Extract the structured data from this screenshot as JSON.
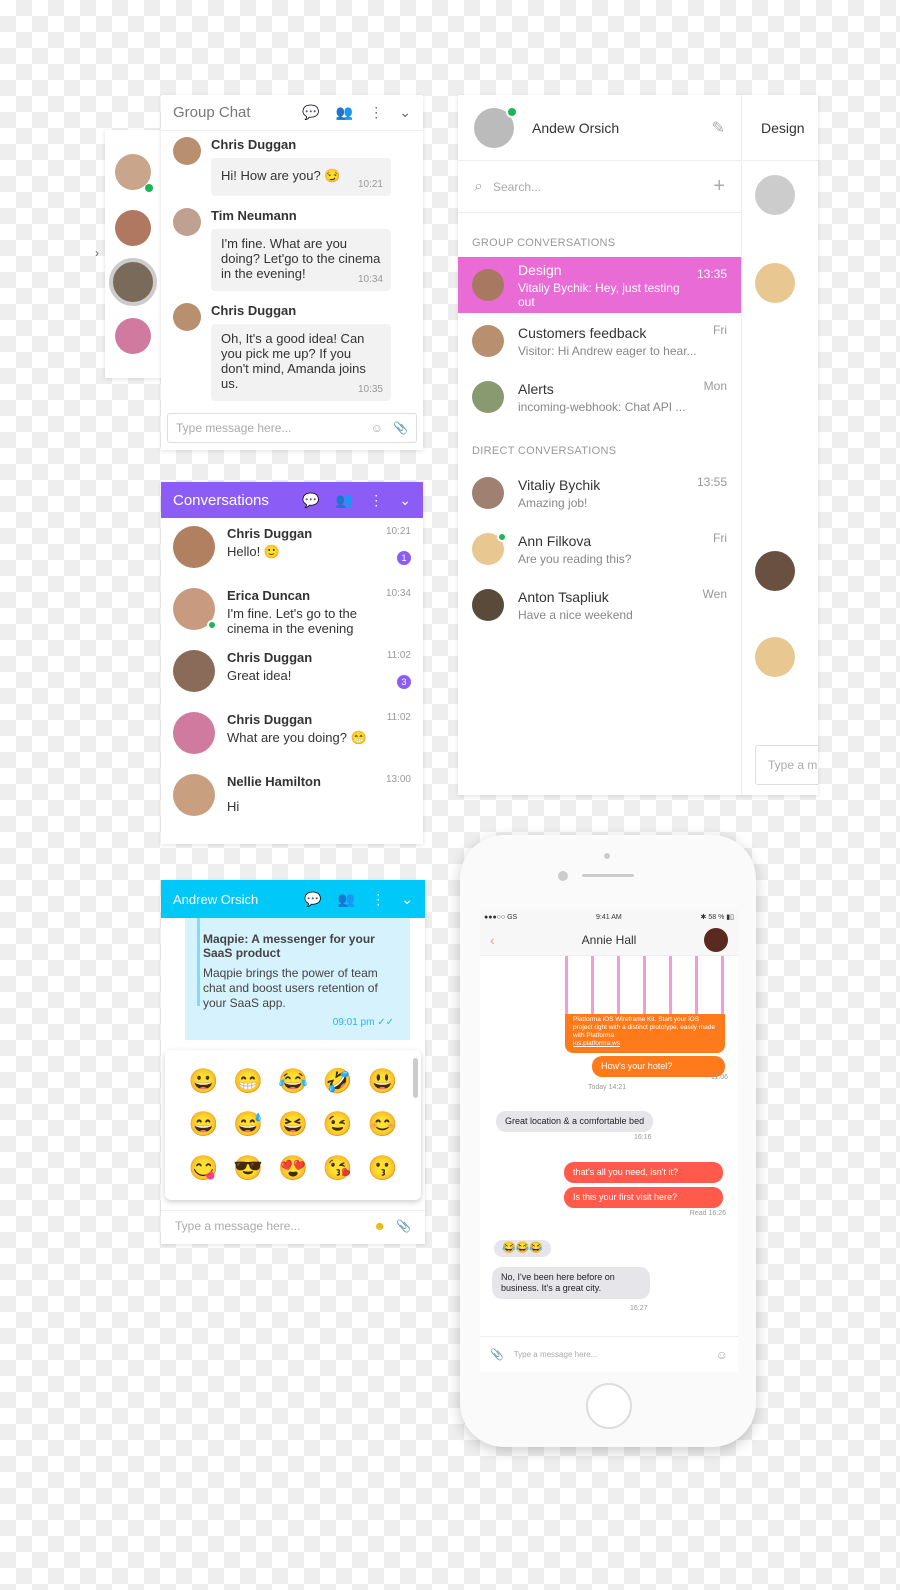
{
  "group_chat": {
    "title": "Group Chat",
    "messages": [
      {
        "name": "Chris Duggan",
        "text": "Hi! How are you? 😏",
        "time": "10:21"
      },
      {
        "name": "Tim Neumann",
        "text": "I'm fine. What are you doing? Let'go to the cinema in the evening!",
        "time": "10:34"
      },
      {
        "name": "Chris Duggan",
        "text": "Oh, It's a good idea! Can you pick me up? If you don't mind, Amanda joins us.",
        "time": "10:35"
      }
    ],
    "input_placeholder": "Type message here..."
  },
  "conversations": {
    "title": "Conversations",
    "header_color": "#8b5cf6",
    "items": [
      {
        "name": "Chris Duggan",
        "text": "Hello! 🙂",
        "time": "10:21",
        "badge": "1"
      },
      {
        "name": "Erica Duncan",
        "text": "I'm fine. Let's go to the cinema in the evening",
        "time": "10:34",
        "badge": ""
      },
      {
        "name": "Chris Duggan",
        "text": "Great idea!",
        "time": "11:02",
        "badge": "3"
      },
      {
        "name": "Chris Duggan",
        "text": "What are you doing? 😁",
        "time": "11:02",
        "badge": ""
      },
      {
        "name": "Nellie Hamilton",
        "text": "Hi",
        "time": "13:00",
        "badge": ""
      }
    ]
  },
  "andrew_panel": {
    "title": "Andrew Orsich",
    "header_color": "#00c8f8",
    "card_title": "Maqpie: A messenger for your SaaS product",
    "card_body": "Maqpie brings the power of team chat and boost users retention of your SaaS app.",
    "card_time": "09:01 pm",
    "emojis": [
      "😀",
      "😁",
      "😂",
      "🤣",
      "😃",
      "😄",
      "😅",
      "😆",
      "😉",
      "😊",
      "😋",
      "😎",
      "😍",
      "😘",
      "😗"
    ],
    "input_placeholder": "Type a message here..."
  },
  "messenger": {
    "user": "Andew Orsich",
    "search_placeholder": "Search...",
    "group_header": "GROUP CONVERSATIONS",
    "groups": [
      {
        "name": "Design",
        "preview": "Vitaliy Bychik: Hey, just testing out",
        "time": "13:35",
        "active": true
      },
      {
        "name": "Customers feedback",
        "preview": "Visitor: Hi Andrew eager to hear...",
        "time": "Fri"
      },
      {
        "name": "Alerts",
        "preview": "incoming-webhook: Chat API ...",
        "time": "Mon"
      }
    ],
    "direct_header": "DIRECT CONVERSATIONS",
    "directs": [
      {
        "name": "Vitaliy Bychik",
        "preview": "Amazing job!",
        "time": "13:55"
      },
      {
        "name": "Ann Filkova",
        "preview": "Are you reading this?",
        "time": "Fri"
      },
      {
        "name": "Anton Tsapliuk",
        "preview": "Have a nice weekend",
        "time": "Wen"
      }
    ],
    "channel_title": "Design",
    "channel_input": "Type a m",
    "accent": "#e96bd6"
  },
  "phone": {
    "carrier": "●●●○○ GS",
    "clock": "9:41 AM",
    "battery": "58 %",
    "contact": "Annie Hall",
    "card_text": "Platforma iOS Wireframe Kit. Start your iOS project right with a distinct prototype, easily made with Platforma",
    "card_link": "ios.platforma.ws",
    "m1": "How's your hotel?",
    "t1": "11:06",
    "day": "Today 14:21",
    "m2": "Great location & a comfortable bed",
    "t2": "16:16",
    "m3": "that's all you need, isn't it?",
    "m4": "Is this your first visit here?",
    "t3": "Read 16:26",
    "m5": "😂😂😂",
    "m6": "No, I've been here before on business. It's a great city.",
    "t4": "16:27",
    "input_placeholder": "Type a message here..."
  }
}
